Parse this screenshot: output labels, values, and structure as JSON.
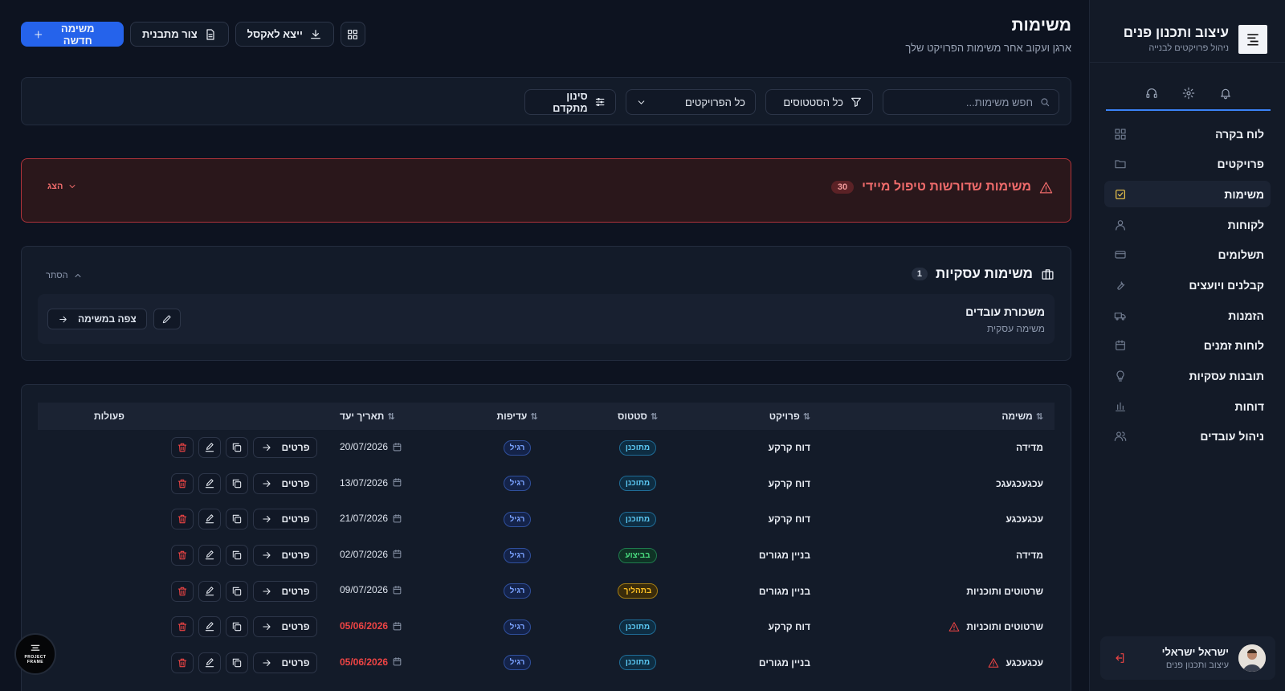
{
  "app": {
    "brand_title": "עיצוב ותכנון פנים",
    "brand_sub": "ניהול פרויקטים לבנייה"
  },
  "sidebar": {
    "items": [
      {
        "label": "לוח בקרה",
        "icon": "dashboard-icon"
      },
      {
        "label": "פרויקטים",
        "icon": "folder-icon"
      },
      {
        "label": "משימות",
        "icon": "tasks-icon",
        "active": true
      },
      {
        "label": "לקוחות",
        "icon": "user-icon"
      },
      {
        "label": "תשלומים",
        "icon": "credit-card-icon"
      },
      {
        "label": "קבלנים ויועצים",
        "icon": "wrench-icon"
      },
      {
        "label": "הזמנות",
        "icon": "truck-icon"
      },
      {
        "label": "לוחות זמנים",
        "icon": "calendar-icon"
      },
      {
        "label": "תובנות עסקיות",
        "icon": "lightbulb-icon"
      },
      {
        "label": "דוחות",
        "icon": "bar-chart-icon"
      },
      {
        "label": "ניהול עובדים",
        "icon": "users-icon"
      }
    ],
    "user": {
      "name": "ישראל ישראלי",
      "role": "עיצוב ותכנון פנים"
    }
  },
  "header": {
    "title": "משימות",
    "subtitle": "ארגן ועקוב אחר משימות הפרויקט שלך",
    "new_task": "משימה חדשה",
    "create_template": "צור מתבנית",
    "export_excel": "ייצא לאקסל"
  },
  "filters": {
    "search_placeholder": "חפש משימות...",
    "status": "כל הסטטוסים",
    "projects": "כל הפרויקטים",
    "advanced": "סינון מתקדם"
  },
  "alert": {
    "title": "משימות שדורשות טיפול מיידי",
    "count": "30",
    "toggle": "הצג"
  },
  "business": {
    "title": "משימות עסקיות",
    "count": "1",
    "hide": "הסתר",
    "card": {
      "name": "משכורת עובדים",
      "type": "משימה עסקית",
      "view": "צפה במשימה"
    }
  },
  "table": {
    "headers": {
      "task": "משימה",
      "project": "פרויקט",
      "status": "סטטוס",
      "priority": "עדיפות",
      "due": "תאריך יעד",
      "actions": "פעולות"
    },
    "details_label": "פרטים",
    "rows": [
      {
        "task": "מדידה",
        "project": "דוח קרקע",
        "status": "מתוכנן",
        "status_kind": "plan",
        "priority": "רגיל",
        "due": "20/07/2026",
        "overdue": false
      },
      {
        "task": "עכגעכגעגכ",
        "project": "דוח קרקע",
        "status": "מתוכנן",
        "status_kind": "plan",
        "priority": "רגיל",
        "due": "13/07/2026",
        "overdue": false
      },
      {
        "task": "עכגעכגע",
        "project": "דוח קרקע",
        "status": "מתוכנן",
        "status_kind": "plan",
        "priority": "רגיל",
        "due": "21/07/2026",
        "overdue": false
      },
      {
        "task": "מדידה",
        "project": "בניין מגורים",
        "status": "בביצוע",
        "status_kind": "exec",
        "priority": "רגיל",
        "due": "02/07/2026",
        "overdue": false
      },
      {
        "task": "שרטוטים ותוכניות",
        "project": "בניין מגורים",
        "status": "בתהליך",
        "status_kind": "prog",
        "priority": "רגיל",
        "due": "09/07/2026",
        "overdue": false
      },
      {
        "task": "שרטוטים ותוכניות",
        "project": "דוח קרקע",
        "status": "מתוכנן",
        "status_kind": "plan",
        "priority": "רגיל",
        "due": "05/06/2026",
        "overdue": true
      },
      {
        "task": "עכגעכגע",
        "project": "בניין מגורים",
        "status": "מתוכנן",
        "status_kind": "plan",
        "priority": "רגיל",
        "due": "05/06/2026",
        "overdue": true
      }
    ]
  },
  "floating_logo": {
    "line1": "PROJECT",
    "line2": "FRAME"
  },
  "colors": {
    "accent": "#2563eb",
    "danger": "#ef4444",
    "background": "#0d1320"
  }
}
